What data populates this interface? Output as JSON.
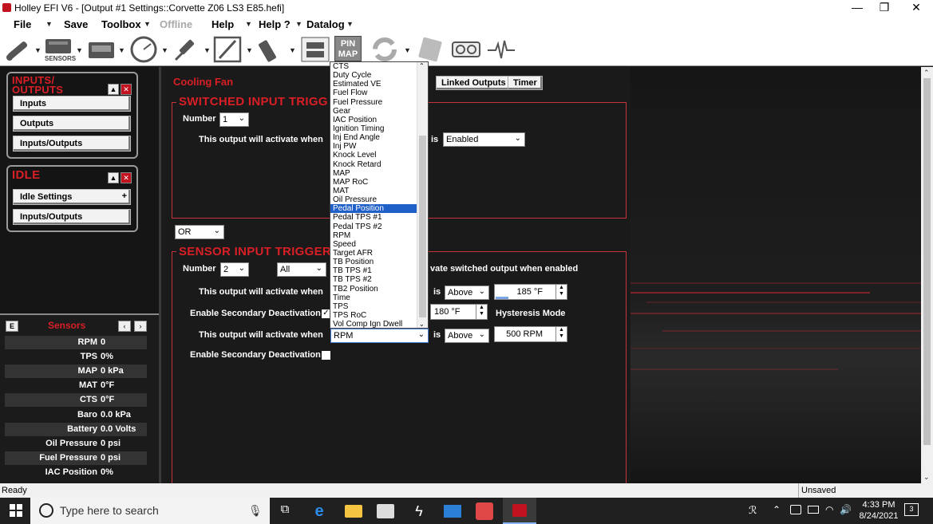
{
  "window": {
    "title": "Holley EFI V6 - [Output #1 Settings::Corvette Z06 LS3 E85.hefi]",
    "controls": {
      "minimize": "—",
      "restore": "❐",
      "close": "✕"
    }
  },
  "menu": [
    "File",
    "Save",
    "Toolbox",
    "Offline",
    "Help",
    "Help ?",
    "Datalog"
  ],
  "toolbar": {
    "sensors_label": "SENSORS",
    "pin_map_label_1": "PIN",
    "pin_map_label_2": "MAP"
  },
  "left": {
    "io_group": {
      "title_1": "INPUTS/",
      "title_2": "OUTPUTS",
      "buttons": [
        "Inputs",
        "Outputs",
        "Inputs/Outputs"
      ]
    },
    "idle_group": {
      "title": "IDLE",
      "buttons": [
        "Idle Settings",
        "Inputs/Outputs"
      ],
      "plus": "+"
    },
    "sensors": {
      "title": "Sensors",
      "e_label": "E",
      "rows": [
        {
          "label": "RPM",
          "value": "0"
        },
        {
          "label": "TPS",
          "value": "0%"
        },
        {
          "label": "MAP",
          "value": "0 kPa"
        },
        {
          "label": "MAT",
          "value": "0°F"
        },
        {
          "label": "CTS",
          "value": "0°F"
        },
        {
          "label": "Baro",
          "value": "0.0 kPa"
        },
        {
          "label": "Battery",
          "value": "0.0 Volts"
        },
        {
          "label": "Oil Pressure",
          "value": "0 psi"
        },
        {
          "label": "Fuel Pressure",
          "value": "0 psi"
        },
        {
          "label": "IAC Position",
          "value": "0%"
        }
      ]
    }
  },
  "main": {
    "output_name": "Cooling Fan",
    "tabs": [
      "Linked Outputs",
      "Timer"
    ],
    "switched": {
      "title": "SWITCHED INPUT TRIGG",
      "number_label": "Number",
      "number_value": "1",
      "activate_label": "This output will activate when",
      "is_label": "is",
      "state_value": "Enabled"
    },
    "logic_value": "OR",
    "sensor": {
      "title": "SENSOR INPUT TRIGGER",
      "number_label": "Number",
      "number_value": "2",
      "all_value": "All",
      "switched_note": "vate switched output when enabled",
      "row1": {
        "label": "This output will activate when",
        "is": "is",
        "cond": "Above",
        "value": "185 °F"
      },
      "secondary1": {
        "label": "Enable Secondary Deactivation",
        "value": "180 °F",
        "hysteresis": "Hysteresis Mode"
      },
      "row2": {
        "label": "This output will activate when",
        "sensor": "RPM",
        "is": "is",
        "cond": "Above",
        "value": "500 RPM"
      },
      "secondary2": {
        "label": "Enable Secondary Deactivation"
      }
    },
    "dropdown": {
      "selected_index": 16,
      "items": [
        "CTS",
        "Duty Cycle",
        "Estimated VE",
        "Fuel Flow",
        "Fuel Pressure",
        "Gear",
        "IAC Position",
        "Ignition Timing",
        "Inj End Angle",
        "Inj PW",
        "Knock Level",
        "Knock Retard",
        "MAP",
        "MAP RoC",
        "MAT",
        "Oil Pressure",
        "Pedal Position",
        "Pedal TPS #1",
        "Pedal TPS #2",
        "RPM",
        "Speed",
        "Target AFR",
        "TB Position",
        "TB TPS #1",
        "TB TPS #2",
        "TB2 Position",
        "Time",
        "TPS",
        "TPS RoC",
        "Vol Comp Ign Dwell"
      ]
    }
  },
  "status": {
    "left": "Ready",
    "right": "Unsaved"
  },
  "taskbar": {
    "search_placeholder": "Type here to search",
    "time": "4:33 PM",
    "date": "8/24/2021",
    "notifications": "3"
  }
}
